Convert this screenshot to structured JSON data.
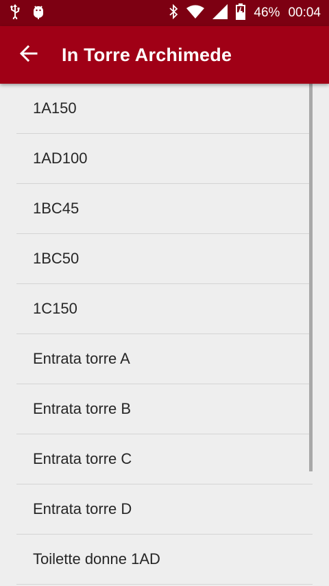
{
  "status_bar": {
    "icons_left": [
      "usb-icon",
      "android-debug-icon"
    ],
    "icons_right": [
      "bluetooth-icon",
      "wifi-icon",
      "cell-signal-icon",
      "battery-icon"
    ],
    "battery": "46%",
    "time": "00:04"
  },
  "app_bar": {
    "title": "In Torre Archimede",
    "back_icon": "arrow-back-icon",
    "color": "#a00016"
  },
  "list": {
    "items": [
      {
        "label": "1A150"
      },
      {
        "label": "1AD100"
      },
      {
        "label": "1BC45"
      },
      {
        "label": "1BC50"
      },
      {
        "label": "1C150"
      },
      {
        "label": "Entrata torre A"
      },
      {
        "label": "Entrata torre B"
      },
      {
        "label": "Entrata torre C"
      },
      {
        "label": "Entrata torre D"
      },
      {
        "label": "Toilette donne 1AD"
      }
    ]
  }
}
